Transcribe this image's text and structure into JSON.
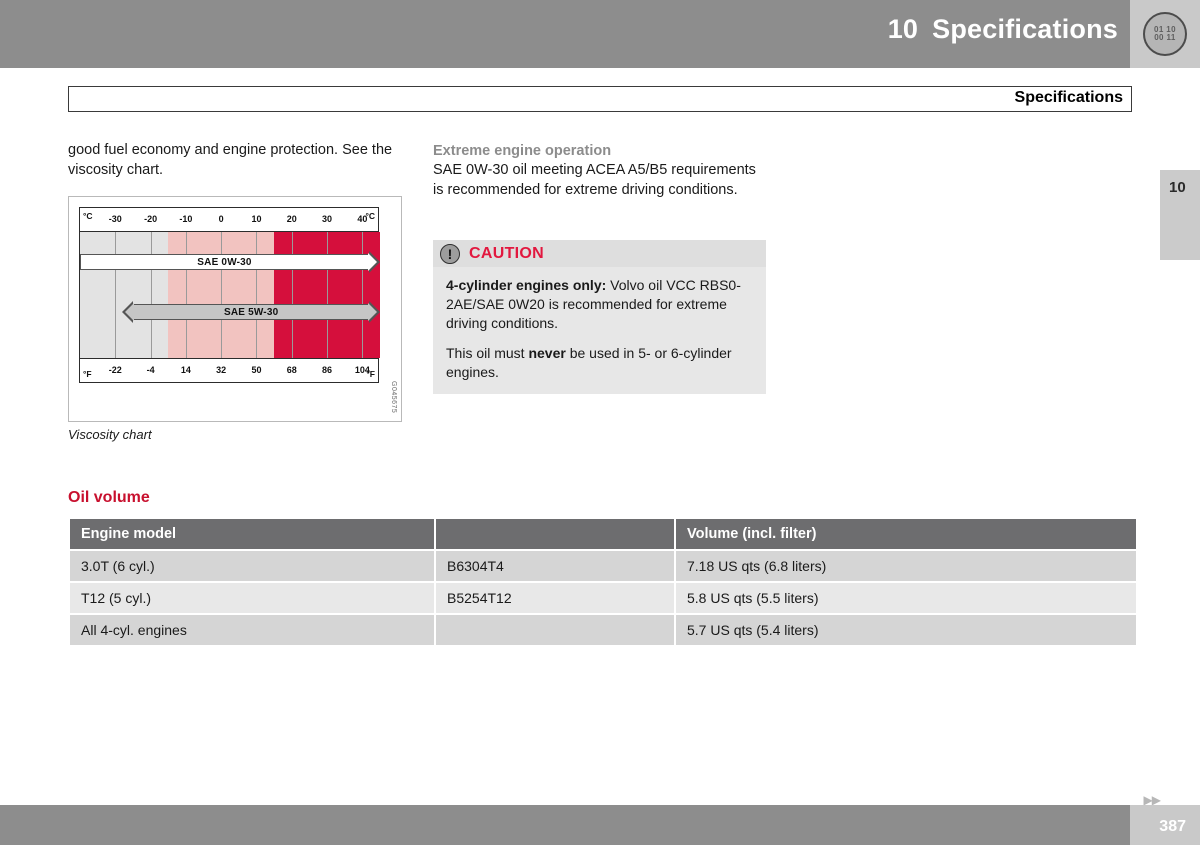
{
  "header": {
    "chapter_number": "10",
    "chapter_title": "Specifications",
    "badge_line1": "01 10",
    "badge_line2": "00 11"
  },
  "breadcrumb": {
    "label": "Specifications"
  },
  "side_tab": {
    "label": "10"
  },
  "left_column": {
    "body_text": "good fuel economy and engine protection. See the viscosity chart.",
    "figure_caption": "Viscosity chart",
    "figure_code": "G045675"
  },
  "right_column": {
    "subheading": "Extreme engine operation",
    "paragraph": "SAE 0W-30 oil meeting ACEA A5/B5 requirements is recommended for extreme driving conditions."
  },
  "caution": {
    "icon": "exclamation-icon",
    "title": "CAUTION",
    "title_color": "#e2183f",
    "para1_bold": "4-cylinder engines only:",
    "para1_rest": " Volvo oil VCC RBS0-2AE/SAE 0W20 is recommended for extreme driving conditions.",
    "para2_pre": "This oil must ",
    "para2_bold": "never",
    "para2_post": " be used in 5- or 6-cylinder engines."
  },
  "oil_volume": {
    "section_title": "Oil volume",
    "section_title_color": "#c8102e",
    "columns": [
      "Engine model",
      "",
      "Volume (incl. filter)"
    ],
    "rows": [
      {
        "model": "3.0T (6 cyl.)",
        "code": "B6304T4",
        "volume": "7.18 US qts (6.8 liters)"
      },
      {
        "model": "T12 (5 cyl.)",
        "code": "B5254T12",
        "volume": "5.8 US qts (5.5 liters)"
      },
      {
        "model": "All 4-cyl. engines",
        "code": "",
        "volume": "5.7 US qts (5.4 liters)"
      }
    ]
  },
  "footer": {
    "page_number": "387",
    "next_arrows": "▶▶"
  },
  "chart_data": {
    "type": "bar",
    "title": "Viscosity chart",
    "orientation": "horizontal",
    "xlabel_left": "°C",
    "xlabel_right": "°C",
    "xlabel_left_bottom": "°F",
    "xlabel_right_bottom": "°F",
    "xlim": [
      -40,
      45
    ],
    "celsius_ticks": [
      -30,
      -20,
      -10,
      0,
      10,
      20,
      30,
      40
    ],
    "fahrenheit_ticks": [
      -22,
      -4,
      14,
      32,
      50,
      68,
      86,
      104
    ],
    "background_bands": [
      {
        "name": "cold",
        "from": -40,
        "to": -15,
        "color": "#e3e3e3"
      },
      {
        "name": "moderate",
        "from": -15,
        "to": 15,
        "color": "#f2c3c0"
      },
      {
        "name": "hot",
        "from": 15,
        "to": 45,
        "color": "#d50f3c"
      }
    ],
    "gridlines_celsius": [
      -30,
      -20,
      -10,
      0,
      10,
      20,
      30,
      40
    ],
    "series": [
      {
        "name": "SAE 0W-30",
        "label": "SAE 0W-30",
        "from": -40,
        "to": 45,
        "arrow_left": false,
        "arrow_right": true,
        "fill": "#ffffff",
        "stroke": "#555555"
      },
      {
        "name": "SAE 5W-30",
        "label": "SAE 5W-30",
        "from": -28,
        "to": 45,
        "arrow_left": true,
        "arrow_right": true,
        "fill": "#c6c6c6",
        "stroke": "#555555"
      }
    ],
    "grid": true,
    "legend": "none"
  }
}
